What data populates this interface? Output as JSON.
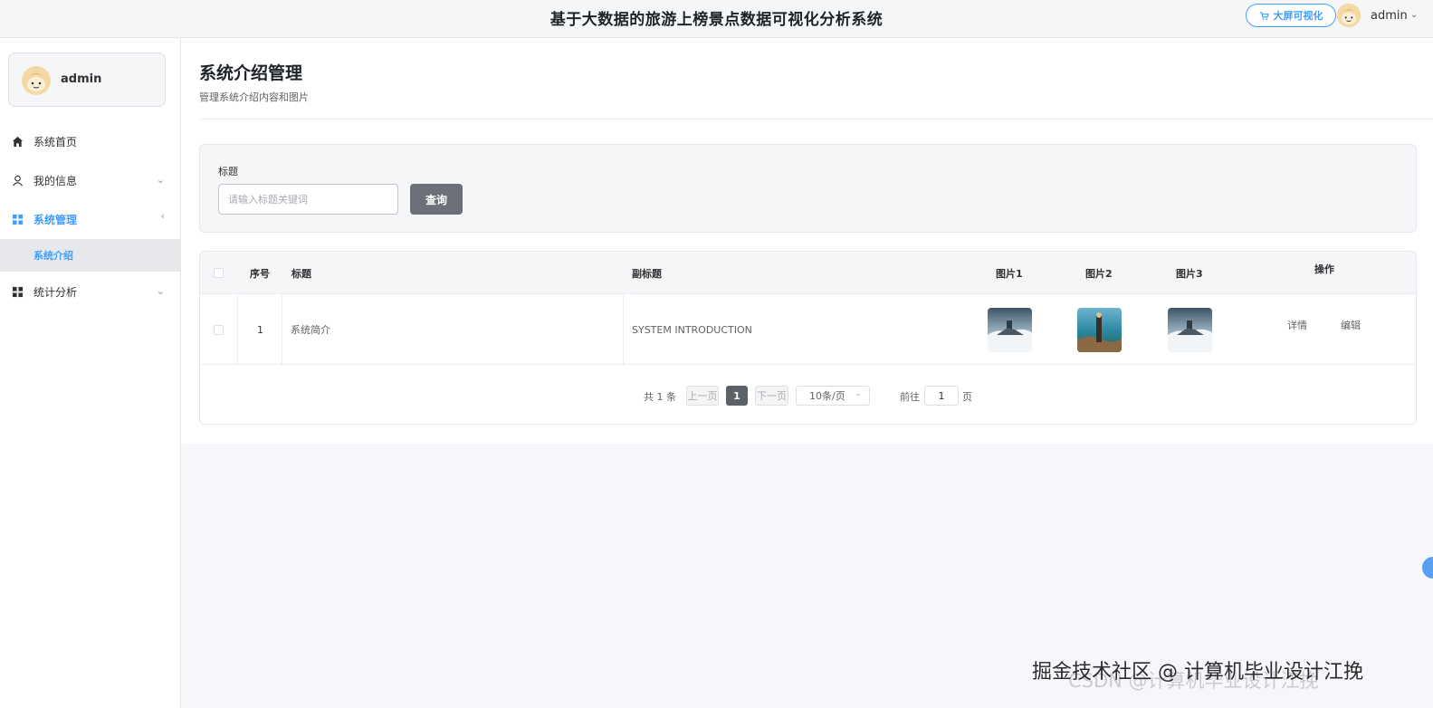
{
  "header": {
    "title": "基于大数据的旅游上榜景点数据可视化分析系统",
    "screen_button": "大屏可视化",
    "username": "admin"
  },
  "sidebar": {
    "profile_name": "admin",
    "items": [
      {
        "label": "系统首页",
        "icon": "home-icon"
      },
      {
        "label": "我的信息",
        "icon": "user-icon"
      },
      {
        "label": "系统管理",
        "icon": "grid-icon"
      },
      {
        "label": "统计分析",
        "icon": "grid-icon"
      }
    ],
    "submenu_active": "系统介绍"
  },
  "page": {
    "title": "系统介绍管理",
    "subtitle": "管理系统介绍内容和图片"
  },
  "search": {
    "label": "标题",
    "placeholder": "请输入标题关键词",
    "button": "查询"
  },
  "table": {
    "headers": {
      "index": "序号",
      "title": "标题",
      "subtitle": "副标题",
      "img1": "图片1",
      "img2": "图片2",
      "img3": "图片3",
      "ops": "操作"
    },
    "rows": [
      {
        "index": "1",
        "title": "系统简介",
        "subtitle": "SYSTEM INTRODUCTION",
        "detail": "详情",
        "edit": "编辑"
      }
    ]
  },
  "pager": {
    "total": "共 1 条",
    "prev": "上一页",
    "current": "1",
    "next": "下一页",
    "size": "10条/页",
    "goto": "前往",
    "goto_value": "1",
    "unit": "页"
  },
  "watermark": "掘金技术社区 @ 计算机毕业设计江挽",
  "watermark_under": "CSDN @计算机毕业设计江挽",
  "colors": {
    "accent": "#409eff",
    "dark_button": "#6b7079"
  }
}
